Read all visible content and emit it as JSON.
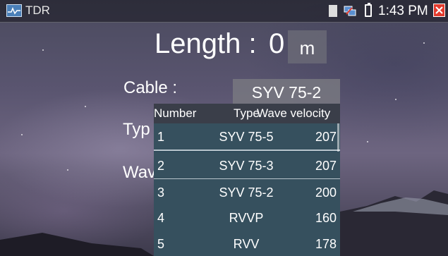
{
  "statusbar": {
    "app_title": "TDR",
    "time": "1:43 PM",
    "icons": [
      "tdr-app-icon",
      "sd-card-icon",
      "network-icon",
      "battery-icon",
      "close-icon"
    ]
  },
  "length": {
    "label": "Length :",
    "value": "0",
    "unit": "m"
  },
  "cable": {
    "label": "Cable  :",
    "selected": "SYV 75-2"
  },
  "partial_labels": {
    "type": "Typ",
    "wave": "Wav"
  },
  "dropdown": {
    "headers": {
      "number": "Number",
      "type": "Type",
      "wave_velocity": "Wave velocity"
    },
    "rows": [
      {
        "number": "1",
        "type": "SYV 75-5",
        "velocity": "207"
      },
      {
        "number": "2",
        "type": "SYV 75-3",
        "velocity": "207"
      },
      {
        "number": "3",
        "type": "SYV 75-2",
        "velocity": "200"
      },
      {
        "number": "4",
        "type": "RVVP",
        "velocity": "160"
      },
      {
        "number": "5",
        "type": "RVV",
        "velocity": "178"
      }
    ]
  },
  "colors": {
    "close_button": "#e23b2e",
    "dropdown_row": "#36505e",
    "row_divider": "#b8c4cc"
  }
}
